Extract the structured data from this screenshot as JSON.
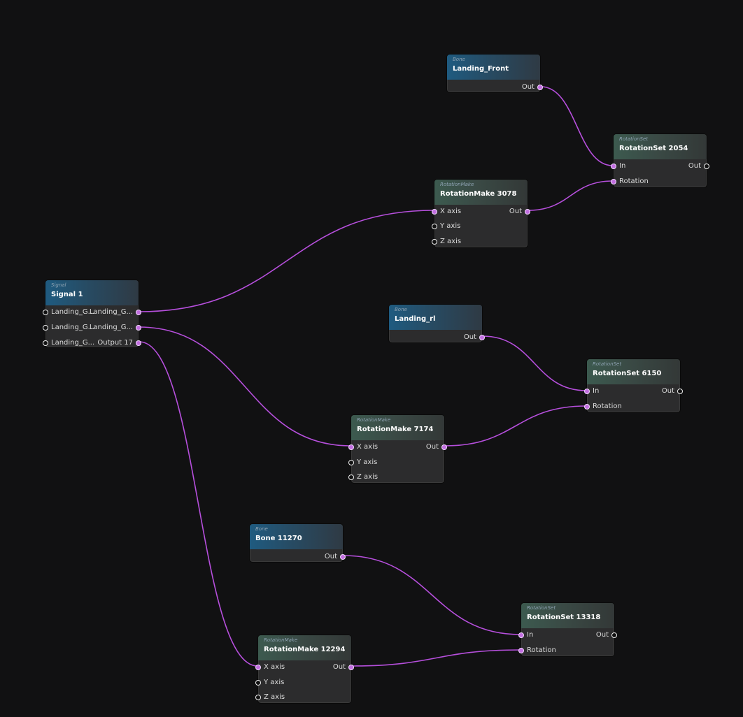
{
  "colors": {
    "wire": "#b64fdc",
    "background": "#111112"
  },
  "nodes": {
    "landing_front": {
      "type": "Bone",
      "title": "Landing_Front",
      "out": "Out"
    },
    "rotset_2054": {
      "type": "RotationSet",
      "title": "RotationSet 2054",
      "in": "In",
      "rotation": "Rotation",
      "out": "Out"
    },
    "rotmake_3078": {
      "type": "RotationMake",
      "title": "RotationMake 3078",
      "x": "X axis",
      "y": "Y axis",
      "z": "Z axis",
      "out": "Out"
    },
    "signal_1": {
      "type": "Signal",
      "title": "Signal 1",
      "in1": "Landing_G...",
      "in2": "Landing_G...",
      "in3": "Landing_G...",
      "out1": "Landing_G...",
      "out2": "Landing_G...",
      "out3": "Output 17"
    },
    "landing_rl": {
      "type": "Bone",
      "title": "Landing_rl",
      "out": "Out"
    },
    "rotset_6150": {
      "type": "RotationSet",
      "title": "RotationSet 6150",
      "in": "In",
      "rotation": "Rotation",
      "out": "Out"
    },
    "rotmake_7174": {
      "type": "RotationMake",
      "title": "RotationMake 7174",
      "x": "X axis",
      "y": "Y axis",
      "z": "Z axis",
      "out": "Out"
    },
    "bone_11270": {
      "type": "Bone",
      "title": "Bone 11270",
      "out": "Out"
    },
    "rotset_13318": {
      "type": "RotationSet",
      "title": "RotationSet 13318",
      "in": "In",
      "rotation": "Rotation",
      "out": "Out"
    },
    "rotmake_12294": {
      "type": "RotationMake",
      "title": "RotationMake 12294",
      "x": "X axis",
      "y": "Y axis",
      "z": "Z axis",
      "out": "Out"
    }
  }
}
